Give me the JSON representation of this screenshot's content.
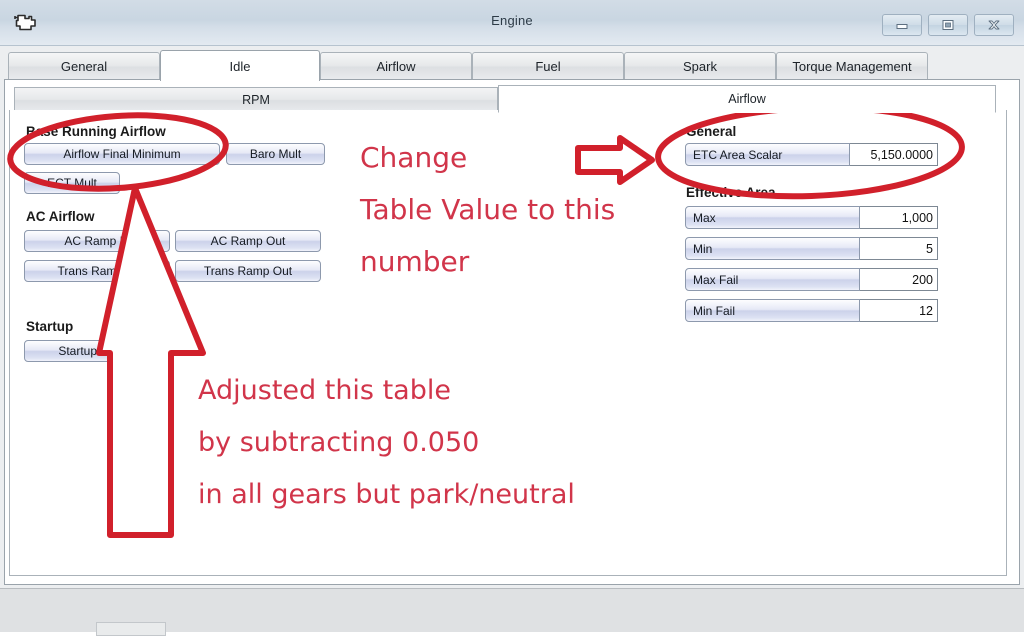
{
  "window": {
    "title": "Engine",
    "icon": "engine-icon",
    "controls": [
      {
        "name": "minimize-button",
        "glyph": "minimize"
      },
      {
        "name": "restore-button",
        "glyph": "restore"
      },
      {
        "name": "close-button",
        "glyph": "close"
      }
    ]
  },
  "tabs": {
    "main": [
      {
        "label": "General",
        "active": false
      },
      {
        "label": "Idle",
        "active": true
      },
      {
        "label": "Airflow",
        "active": false
      },
      {
        "label": "Fuel",
        "active": false
      },
      {
        "label": "Spark",
        "active": false
      },
      {
        "label": "Torque Management",
        "active": false
      }
    ],
    "sub": [
      {
        "label": "RPM",
        "active": false
      },
      {
        "label": "Airflow",
        "active": true
      }
    ]
  },
  "left_panel": {
    "groups": [
      {
        "title": "Base Running Airflow",
        "buttons": [
          {
            "label": "Airflow Final Minimum"
          },
          {
            "label": "Baro Mult"
          },
          {
            "label": "ECT Mult"
          }
        ]
      },
      {
        "title": "AC Airflow",
        "buttons": [
          {
            "label": "AC Ramp In"
          },
          {
            "label": "AC Ramp Out"
          },
          {
            "label": "Trans Ramp In"
          },
          {
            "label": "Trans Ramp Out"
          }
        ]
      },
      {
        "title": "Startup",
        "buttons": [
          {
            "label": "Startup Airflow"
          }
        ]
      }
    ]
  },
  "right_panel": {
    "groups": [
      {
        "title": "General",
        "fields": [
          {
            "label": "ETC Area Scalar",
            "value": "5,150.0000"
          }
        ]
      },
      {
        "title": "Effective Area",
        "fields": [
          {
            "label": "Max",
            "value": "1,000"
          },
          {
            "label": "Min",
            "value": "5"
          },
          {
            "label": "Max Fail",
            "value": "200"
          },
          {
            "label": "Min Fail",
            "value": "12"
          }
        ]
      }
    ]
  },
  "annotations": {
    "color": "#d1354a",
    "change_line1": "Change",
    "change_line2": "Table Value to this",
    "change_line3": "number",
    "adjust_line1": "Adjusted this table",
    "adjust_line2": "by subtracting 0.050",
    "adjust_line3": "in all gears but park/neutral",
    "shapes": [
      {
        "name": "ellipse-base-running-airflow"
      },
      {
        "name": "ellipse-etc-area-scalar"
      },
      {
        "name": "right-arrow-to-etc-area-scalar"
      },
      {
        "name": "up-arrow-to-airflow-final-minimum"
      }
    ]
  }
}
